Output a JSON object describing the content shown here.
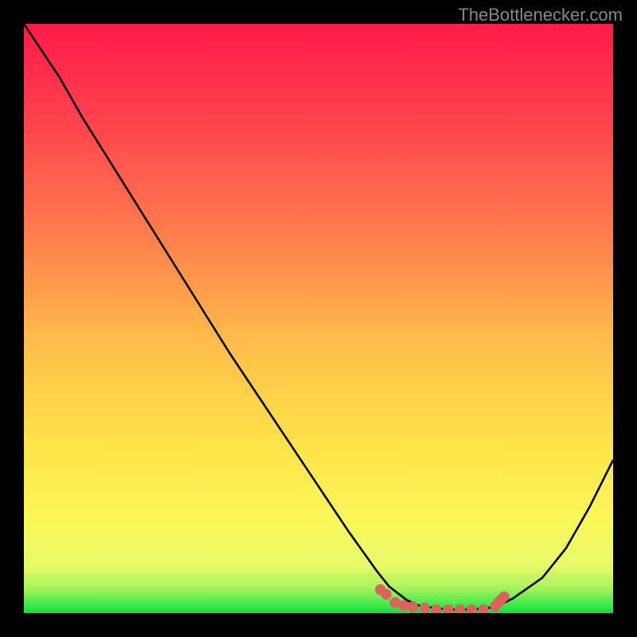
{
  "watermark": "TheBottlenecker.com",
  "chart_data": {
    "type": "line",
    "title": "",
    "xlabel": "",
    "ylabel": "",
    "xlim": [
      0,
      100
    ],
    "ylim": [
      0,
      100
    ],
    "x": [
      0,
      2,
      6,
      10,
      15,
      20,
      25,
      30,
      35,
      40,
      45,
      50,
      55,
      60,
      62,
      65,
      67,
      70,
      73,
      76,
      80,
      83,
      88,
      92,
      96,
      100
    ],
    "y": [
      100,
      97,
      91,
      84,
      76,
      68,
      60,
      52,
      44,
      36.5,
      29,
      21.5,
      14,
      7,
      4.5,
      2.2,
      1.3,
      0.8,
      0.6,
      0.6,
      1,
      2.5,
      6,
      11,
      18,
      26
    ],
    "marker_points": [
      {
        "x": 60.5,
        "y": 4
      },
      {
        "x": 61.5,
        "y": 3.2
      },
      {
        "x": 63,
        "y": 1.8
      },
      {
        "x": 64.5,
        "y": 1.3
      },
      {
        "x": 66,
        "y": 1.1
      },
      {
        "x": 68,
        "y": 0.9
      },
      {
        "x": 70,
        "y": 0.6
      },
      {
        "x": 72,
        "y": 0.6
      },
      {
        "x": 74,
        "y": 0.6
      },
      {
        "x": 76,
        "y": 0.6
      },
      {
        "x": 78,
        "y": 0.6
      },
      {
        "x": 80,
        "y": 1.2
      },
      {
        "x": 80.5,
        "y": 1.8
      },
      {
        "x": 81,
        "y": 2.3
      },
      {
        "x": 81.5,
        "y": 2.8
      }
    ],
    "gradient_stops": [
      {
        "pos": 0,
        "color": "#ff1a4a"
      },
      {
        "pos": 15,
        "color": "#ff3e4d"
      },
      {
        "pos": 35,
        "color": "#ff7a4d"
      },
      {
        "pos": 55,
        "color": "#ffc04a"
      },
      {
        "pos": 72,
        "color": "#ffe44a"
      },
      {
        "pos": 85,
        "color": "#faf85a"
      },
      {
        "pos": 92,
        "color": "#e6fa6a"
      },
      {
        "pos": 96,
        "color": "#9ff25a"
      },
      {
        "pos": 99,
        "color": "#2fe84a"
      },
      {
        "pos": 100,
        "color": "#0fdc3c"
      }
    ],
    "marker_color": "#e06060",
    "curve_color": "#000000"
  }
}
